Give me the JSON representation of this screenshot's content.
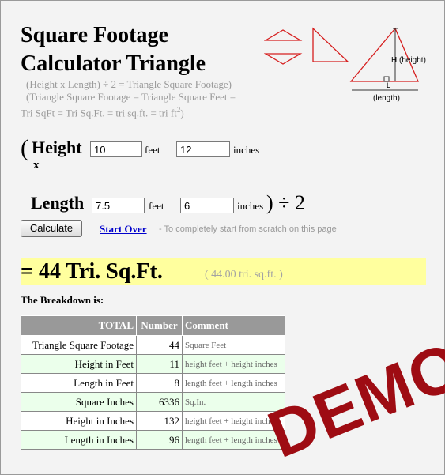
{
  "title_line1": "Square Footage",
  "title_line2": "Calculator Triangle",
  "formula_line1": "(Height x Length) ÷ 2 = Triangle Square Footage)",
  "formula_line2": "(Triangle Square Footage = Triangle Square Feet =",
  "formula_line3": "Tri SqFt = Tri Sq.Ft. = tri sq.ft. = tri ft",
  "formula_line3_sup": "2",
  "formula_line3_end": ")",
  "diagram": {
    "height_label": "H (height)",
    "length_label": "(length)",
    "l_mark": "L"
  },
  "height": {
    "paren_open": "(",
    "label": "Height",
    "x_mark": "x",
    "feet_value": "10",
    "feet_unit": "feet",
    "inches_value": "12",
    "inches_unit": "inches"
  },
  "length": {
    "label": "Length",
    "feet_value": "7.5",
    "feet_unit": "feet",
    "inches_value": "6",
    "inches_unit": "inches",
    "div_text": ") ÷ 2"
  },
  "calculate_label": "Calculate",
  "start_over_label": "Start Over",
  "start_over_note": "- To completely start from scratch on this page",
  "result_big": "= 44 Tri. Sq.Ft.",
  "result_small": "( 44.00 tri. sq.ft. )",
  "breakdown_label": "The Breakdown is:",
  "table": {
    "headers": [
      "TOTAL",
      "Number",
      "Comment"
    ],
    "rows": [
      {
        "total": "Triangle Square Footage",
        "number": "44",
        "comment": "Square Feet"
      },
      {
        "total": "Height in Feet",
        "number": "11",
        "comment": "height feet + height inches"
      },
      {
        "total": "Length in Feet",
        "number": "8",
        "comment": "length feet + length inches"
      },
      {
        "total": "Square Inches",
        "number": "6336",
        "comment": "Sq.In."
      },
      {
        "total": "Height in Inches",
        "number": "132",
        "comment": "height feet + height inches"
      },
      {
        "total": "Length in Inches",
        "number": "96",
        "comment": "length feet + length inches"
      }
    ]
  },
  "watermark": "DEMO",
  "colors": {
    "result_bg": "#ffff9e",
    "table_header_bg": "#999999",
    "row_alt_bg": "#ebffeb",
    "triangle_stroke": "#d61e1e",
    "watermark": "#9e0c13",
    "link": "#0000cc"
  }
}
